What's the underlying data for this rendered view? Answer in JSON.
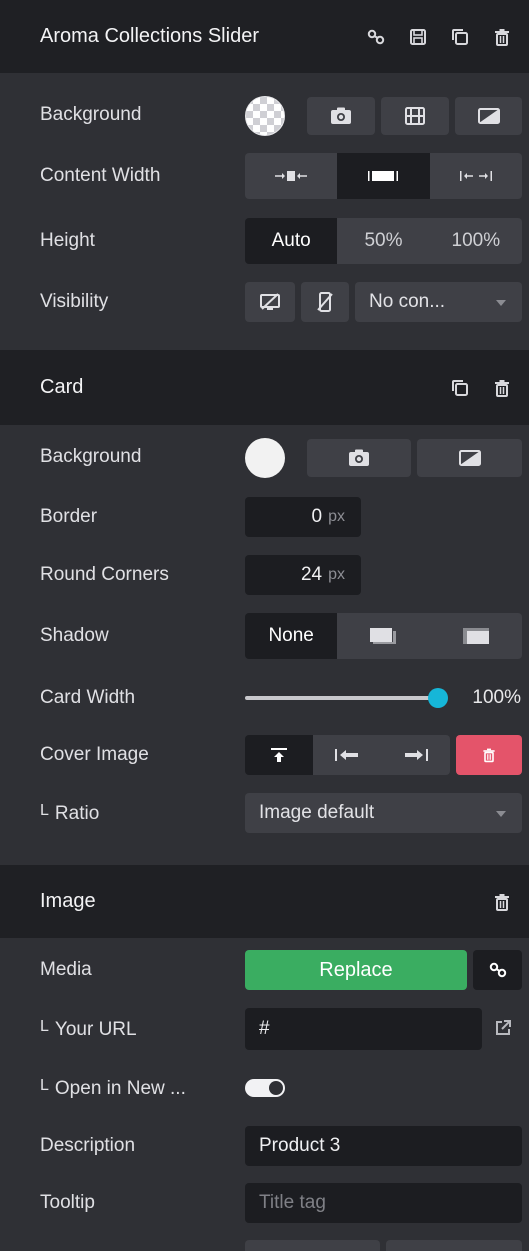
{
  "slider_section": {
    "title": "Aroma Collections Slider",
    "header_icons": [
      "link-icon",
      "save-icon",
      "duplicate-icon",
      "trash-icon"
    ],
    "background_label": "Background",
    "content_width_label": "Content Width",
    "height_label": "Height",
    "height_options": [
      "Auto",
      "50%",
      "100%"
    ],
    "height_selected": "Auto",
    "visibility_label": "Visibility",
    "visibility_select": "No con..."
  },
  "card_section": {
    "title": "Card",
    "background_label": "Background",
    "background_color": "#f2f2f2",
    "border_label": "Border",
    "border_value": "0",
    "border_unit": "px",
    "round_corners_label": "Round Corners",
    "round_corners_value": "24",
    "round_corners_unit": "px",
    "shadow_label": "Shadow",
    "shadow_options": [
      "None"
    ],
    "card_width_label": "Card Width",
    "card_width_value": "100%",
    "card_width_fraction": 1.0,
    "cover_image_label": "Cover Image",
    "ratio_label": "L Ratio",
    "ratio_prefix": "L",
    "ratio_text": "Ratio",
    "ratio_select": "Image default"
  },
  "image_section": {
    "title": "Image",
    "media_label": "Media",
    "replace_button": "Replace",
    "url_prefix": "L",
    "url_label": "Your URL",
    "url_value": "#",
    "new_tab_prefix": "L",
    "new_tab_label": "Open in New ...",
    "description_label": "Description",
    "description_value": "Product 3",
    "tooltip_label": "Tooltip",
    "tooltip_placeholder": "Title tag"
  },
  "colors": {
    "accent_cyan": "#16b6d8",
    "replace_green": "#3aad61",
    "delete_red": "#e4546a",
    "panel_bg": "#2f3035",
    "header_bg": "#1f2024"
  }
}
